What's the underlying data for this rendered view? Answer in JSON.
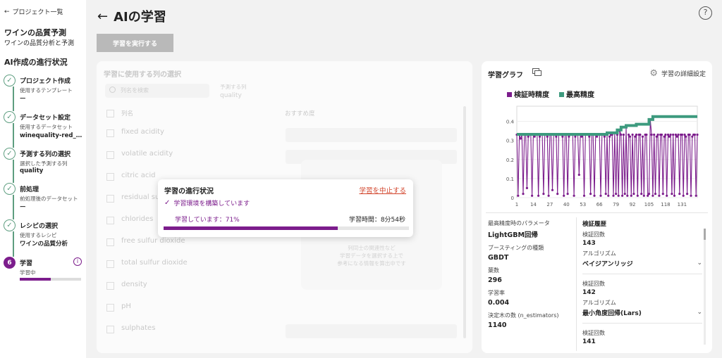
{
  "sidebar": {
    "back_label": "プロジェクト一覧",
    "project_title": "ワインの品質予測",
    "project_subtitle": "ワインの品質分析と予測",
    "progress_title": "AI作成の進行状況",
    "steps": [
      {
        "title": "プロジェクト作成",
        "label": "使用するテンプレート",
        "value": "ー"
      },
      {
        "title": "データセット設定",
        "label": "使用するデータセット",
        "value": "winequality-red_学..."
      },
      {
        "title": "予測する列の選択",
        "label": "選択した予測する列",
        "value": "quality"
      },
      {
        "title": "前処理",
        "label": "前処理後のデータセット",
        "value": "ー"
      },
      {
        "title": "レシピの選択",
        "label": "使用するレシピ",
        "value": "ワインの品質分析"
      },
      {
        "number": "6",
        "title": "学習",
        "label": "学習中",
        "progress": 0.5
      }
    ]
  },
  "header": {
    "title": "AIの学習",
    "run_button": "学習を実行する",
    "help_icon": "?"
  },
  "columns_panel": {
    "title": "学習に使用する列の選択",
    "search_placeholder": "列名を検索",
    "target_label": "予測する列",
    "target_value": "quality",
    "header_name": "列名",
    "header_recommend": "おすすめ度",
    "columns": [
      "fixed acidity",
      "volatile acidity",
      "citric acid",
      "residual sugar",
      "chlorides",
      "free sulfur dioxide",
      "total sulfur dioxide",
      "density",
      "pH",
      "sulphates"
    ],
    "note": [
      "列同士の関連性など",
      "学習データを選択する上で",
      "参考になる情報を算出中です"
    ]
  },
  "progress_modal": {
    "title": "学習の進行状況",
    "stop_link": "学習を中止する",
    "env_status": "学習環境を構築しています",
    "training_status": "学習しています：71%",
    "progress": 0.71,
    "elapsed": "学習時間：8分54秒"
  },
  "graph_panel": {
    "title": "学習グラフ",
    "settings_label": "学習の詳細設定",
    "params": [
      {
        "label": "最高精度時のパラメータ",
        "value": "LightGBM回帰"
      },
      {
        "label": "ブースティングの種類",
        "value": "GBDT"
      },
      {
        "label": "葉数",
        "value": "296"
      },
      {
        "label": "学習率",
        "value": "0.004"
      },
      {
        "label": "決定木の数 (n_estimators)",
        "value": "1140"
      }
    ],
    "history_title": "検証履歴",
    "history": [
      {
        "count_label": "検証回数",
        "count": "143",
        "algo_label": "アルゴリズム",
        "algo": "ベイジアンリッジ"
      },
      {
        "count_label": "検証回数",
        "count": "142",
        "algo_label": "アルゴリズム",
        "algo": "最小角度回帰(Lars)"
      },
      {
        "count_label": "検証回数",
        "count": "141",
        "algo_label": "",
        "algo": ""
      }
    ]
  },
  "colors": {
    "accent": "#7c1d8c",
    "best": "#3d9a7e",
    "step": "#5e9e80",
    "danger": "#d2452c"
  },
  "chart_data": {
    "type": "line",
    "series": [
      {
        "name": "検証時精度",
        "color": "#7c1d8c"
      },
      {
        "name": "最高精度",
        "color": "#3d9a7e"
      }
    ],
    "xticks": [
      1,
      14,
      27,
      40,
      53,
      66,
      79,
      92,
      105,
      118,
      131
    ],
    "yticks": [
      0,
      0.1,
      0.2,
      0.3,
      0.4
    ],
    "xlim": [
      1,
      143
    ],
    "ylim": [
      0,
      0.45
    ],
    "best_steps": [
      [
        1,
        0.332
      ],
      [
        72,
        0.34
      ],
      [
        80,
        0.355
      ],
      [
        83,
        0.37
      ],
      [
        87,
        0.378
      ],
      [
        95,
        0.385
      ],
      [
        105,
        0.41
      ],
      [
        108,
        0.425
      ],
      [
        143,
        0.425
      ]
    ],
    "validation": [
      0.33,
      0.01,
      0.33,
      0.31,
      0.33,
      0.02,
      0.33,
      0.33,
      0.05,
      0.32,
      0.33,
      0.33,
      0.01,
      0.33,
      0.32,
      0.33,
      0.33,
      0.01,
      0.32,
      0.33,
      0.33,
      0.02,
      0.33,
      0.33,
      0.32,
      0.01,
      0.33,
      0.33,
      0.04,
      0.33,
      0.33,
      0.32,
      0.02,
      0.33,
      0.33,
      0.33,
      0.32,
      0.01,
      0.33,
      0.33,
      0.02,
      0.32,
      0.33,
      0.33,
      0.33,
      0.01,
      0.32,
      0.33,
      0.33,
      0.12,
      0.33,
      0.32,
      0.33,
      0.01,
      0.33,
      0.33,
      0.33,
      0.32,
      0.02,
      0.33,
      0.33,
      0.01,
      0.33,
      0.32,
      0.33,
      0.33,
      0.01,
      0.33,
      0.33,
      0.32,
      0.02,
      0.33,
      0.01,
      0.32,
      0.33,
      0.33,
      0.01,
      0.34,
      0.02,
      0.33,
      0.01,
      0.35,
      0.33,
      0.01,
      0.33,
      0.02,
      0.37,
      0.01,
      0.33,
      0.32,
      0.01,
      0.33,
      0.02,
      0.32,
      0.33,
      0.01,
      0.33,
      0.33,
      0.02,
      0.32,
      0.01,
      0.33,
      0.33,
      0.01,
      0.02,
      0.41,
      0.33,
      0.01,
      0.33,
      0.02,
      0.32,
      0.33,
      0.01,
      0.33,
      0.33,
      0.02,
      0.32,
      0.33,
      0.01,
      0.33,
      0.32,
      0.33,
      0.02,
      0.33,
      0.01,
      0.33,
      0.32,
      0.33,
      0.02,
      0.33,
      0.33,
      0.01,
      0.33,
      0.32,
      0.02,
      0.33,
      0.33,
      0.01,
      0.32,
      0.33,
      0.33,
      0.01,
      0.33
    ]
  }
}
